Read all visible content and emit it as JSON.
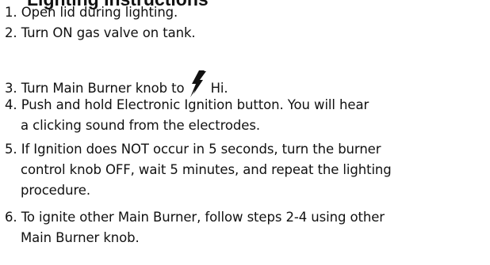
{
  "heading": "Lighting Instructions",
  "steps": [
    {
      "line1": "1. Open lid during lighting."
    },
    {
      "line1": "2. Turn ON gas valve on tank."
    },
    {
      "before_icon": "3. Turn Main Burner knob to ",
      "icon": "lightning-bolt-icon",
      "after_icon": "Hi."
    },
    {
      "line1": "4. Push and hold Electronic Ignition button. You will hear",
      "line2": "a clicking sound from the electrodes."
    },
    {
      "line1": "5. If Ignition does NOT occur in 5 seconds, turn the burner",
      "line2": "control knob OFF, wait 5 minutes, and repeat the lighting",
      "line3": "procedure."
    },
    {
      "line1": "6. To ignite other Main Burner, follow steps 2-4 using other",
      "line2": "Main Burner knob."
    }
  ],
  "colors": {
    "text": "#111111",
    "background": "#ffffff"
  }
}
